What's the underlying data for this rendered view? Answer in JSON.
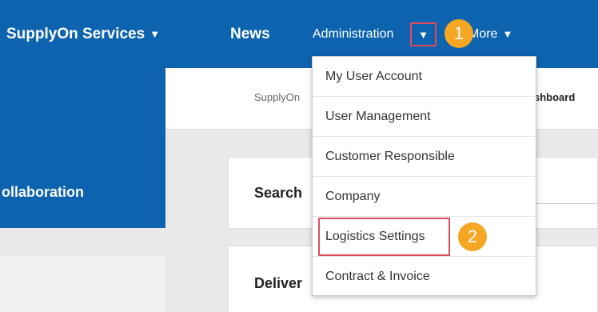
{
  "nav": {
    "services_label": "SupplyOn Services",
    "news_label": "News",
    "admin_label": "Administration",
    "more_label": "More",
    "caret": "▼"
  },
  "callouts": [
    "1",
    "2"
  ],
  "sidebar": {
    "title": "ollaboration"
  },
  "breadcrumb": {
    "items": [
      "SupplyOn",
      "shboard"
    ]
  },
  "cards": {
    "search_title": "Search",
    "delivery_title": "Deliver"
  },
  "dropdown": {
    "items": [
      {
        "label": "My User Account"
      },
      {
        "label": "User Management"
      },
      {
        "label": "Customer Responsible"
      },
      {
        "label": "Company"
      },
      {
        "label": "Logistics Settings"
      },
      {
        "label": "Contract & Invoice"
      }
    ]
  },
  "colors": {
    "brand_blue": "#0d63ad",
    "highlight_red": "#e24b5c",
    "callout_orange": "#f5a623"
  }
}
